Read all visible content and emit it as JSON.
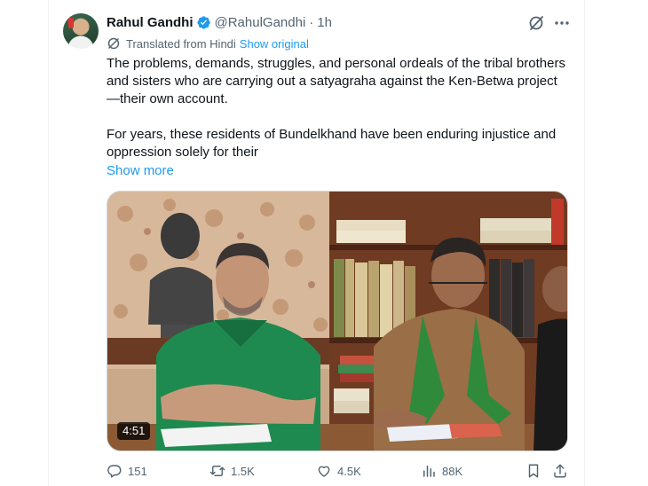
{
  "author": {
    "name": "Rahul Gandhi",
    "handle": "@RahulGandhi",
    "separator": "·",
    "time": "1h"
  },
  "translation": {
    "label": "Translated from Hindi",
    "show_original": "Show original"
  },
  "tweet": {
    "paragraphs": [
      "The problems, demands, struggles, and personal ordeals of the tribal brothers and sisters who are carrying out a satyagraha against the Ken-Betwa project—their own account.",
      "For years, these residents of Bundelkhand have been enduring injustice and oppression solely for their"
    ],
    "show_more": "Show more"
  },
  "media": {
    "type": "video",
    "duration": "4:51"
  },
  "actions": {
    "replies": "151",
    "reposts": "1.5K",
    "likes": "4.5K",
    "views": "88K"
  },
  "colors": {
    "accent": "#1d9bf0",
    "secondary_text": "#536471",
    "primary_text": "#0f1419",
    "divider": "#eff3f4"
  },
  "icons": [
    "verified-badge-icon",
    "grok-icon",
    "more-icon",
    "translate-icon",
    "reply-icon",
    "repost-icon",
    "like-icon",
    "views-icon",
    "bookmark-icon",
    "share-icon"
  ]
}
